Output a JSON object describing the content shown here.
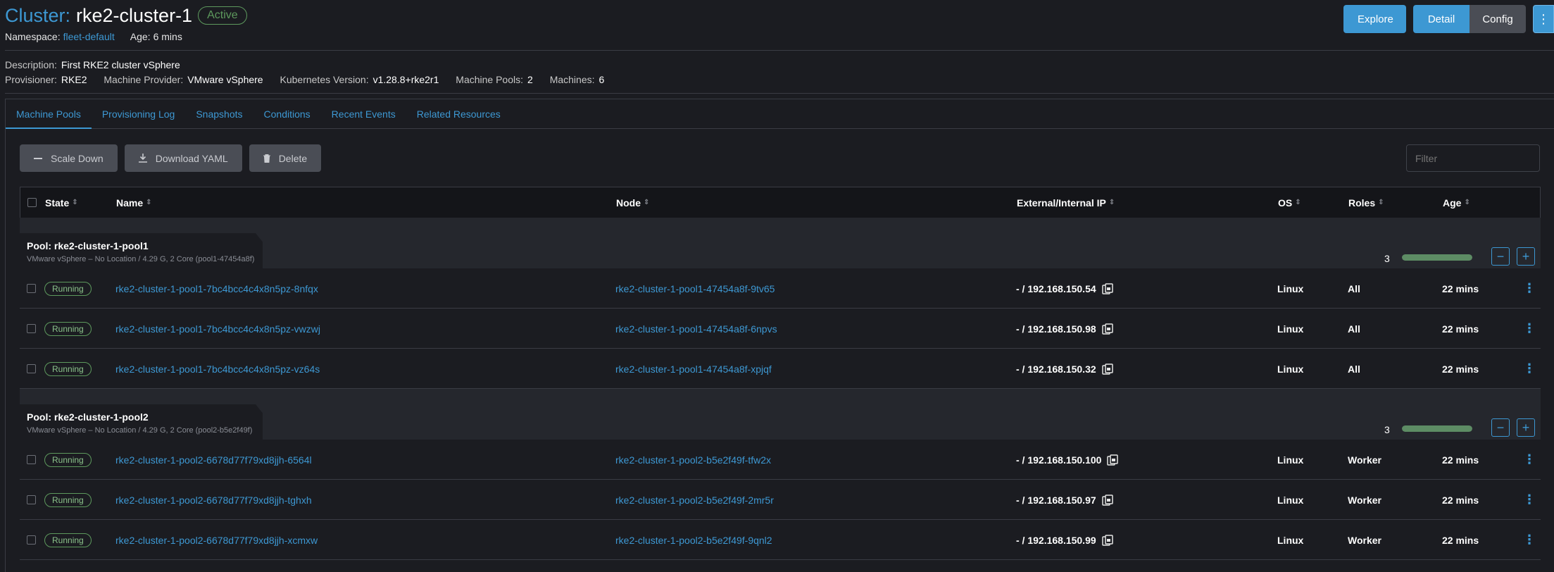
{
  "header": {
    "title_prefix": "Cluster:",
    "title_name": "rke2-cluster-1",
    "status": "Active",
    "namespace_label": "Namespace:",
    "namespace_value": "fleet-default",
    "age_label": "Age:",
    "age_value": "6 mins",
    "explore_label": "Explore",
    "detail_label": "Detail",
    "config_label": "Config",
    "more_label": "⋮"
  },
  "details": {
    "description_label": "Description:",
    "description_value": "First RKE2 cluster vSphere",
    "provisioner_label": "Provisioner:",
    "provisioner_value": "RKE2",
    "machine_provider_label": "Machine Provider:",
    "machine_provider_value": "VMware vSphere",
    "k8s_version_label": "Kubernetes Version:",
    "k8s_version_value": "v1.28.8+rke2r1",
    "machine_pools_label": "Machine Pools:",
    "machine_pools_value": "2",
    "machines_label": "Machines:",
    "machines_value": "6"
  },
  "tabs": [
    {
      "label": "Machine Pools"
    },
    {
      "label": "Provisioning Log"
    },
    {
      "label": "Snapshots"
    },
    {
      "label": "Conditions"
    },
    {
      "label": "Recent Events"
    },
    {
      "label": "Related Resources"
    }
  ],
  "toolbar": {
    "scale_down_label": "Scale Down",
    "download_yaml_label": "Download YAML",
    "delete_label": "Delete",
    "filter_placeholder": "Filter"
  },
  "table": {
    "columns": [
      "State",
      "Name",
      "Node",
      "External/Internal IP",
      "OS",
      "Roles",
      "Age"
    ],
    "pools": [
      {
        "title": "Pool: rke2-cluster-1-pool1",
        "subtitle": "VMware vSphere – No Location / 4.29 G, 2 Core (pool1-47454a8f)",
        "count": "3",
        "progress": 1.0,
        "rows": [
          {
            "state": "Running",
            "name": "rke2-cluster-1-pool1-7bc4bcc4c4x8n5pz-8nfqx",
            "node": "rke2-cluster-1-pool1-47454a8f-9tv65",
            "ip": "- / 192.168.150.54",
            "os": "Linux",
            "roles": "All",
            "age": "22 mins"
          },
          {
            "state": "Running",
            "name": "rke2-cluster-1-pool1-7bc4bcc4c4x8n5pz-vwzwj",
            "node": "rke2-cluster-1-pool1-47454a8f-6npvs",
            "ip": "- / 192.168.150.98",
            "os": "Linux",
            "roles": "All",
            "age": "22 mins"
          },
          {
            "state": "Running",
            "name": "rke2-cluster-1-pool1-7bc4bcc4c4x8n5pz-vz64s",
            "node": "rke2-cluster-1-pool1-47454a8f-xpjqf",
            "ip": "- / 192.168.150.32",
            "os": "Linux",
            "roles": "All",
            "age": "22 mins"
          }
        ]
      },
      {
        "title": "Pool: rke2-cluster-1-pool2",
        "subtitle": "VMware vSphere – No Location / 4.29 G, 2 Core (pool2-b5e2f49f)",
        "count": "3",
        "progress": 1.0,
        "rows": [
          {
            "state": "Running",
            "name": "rke2-cluster-1-pool2-6678d77f79xd8jjh-6564l",
            "node": "rke2-cluster-1-pool2-b5e2f49f-tfw2x",
            "ip": "- / 192.168.150.100",
            "os": "Linux",
            "roles": "Worker",
            "age": "22 mins"
          },
          {
            "state": "Running",
            "name": "rke2-cluster-1-pool2-6678d77f79xd8jjh-tghxh",
            "node": "rke2-cluster-1-pool2-b5e2f49f-2mr5r",
            "ip": "- / 192.168.150.97",
            "os": "Linux",
            "roles": "Worker",
            "age": "22 mins"
          },
          {
            "state": "Running",
            "name": "rke2-cluster-1-pool2-6678d77f79xd8jjh-xcmxw",
            "node": "rke2-cluster-1-pool2-b5e2f49f-9qnl2",
            "ip": "- / 192.168.150.99",
            "os": "Linux",
            "roles": "Worker",
            "age": "22 mins"
          }
        ]
      }
    ]
  },
  "colors": {
    "accent": "#3d98d3",
    "active_green": "#5d995d",
    "background": "#1b1c21"
  }
}
